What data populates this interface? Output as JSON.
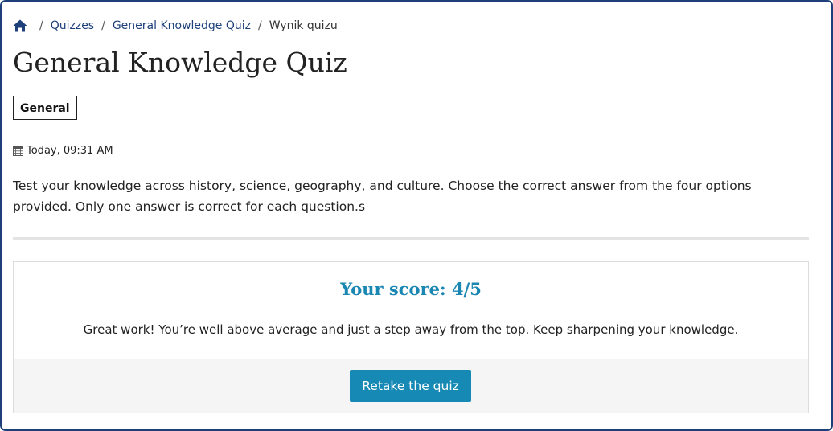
{
  "breadcrumb": {
    "home_icon": "home-icon",
    "separator": "/",
    "items": [
      {
        "label": "Quizzes"
      },
      {
        "label": "General Knowledge Quiz"
      }
    ],
    "current": "Wynik quizu"
  },
  "quiz": {
    "title": "General Knowledge Quiz",
    "category": "General",
    "date_icon": "calendar-icon",
    "date": "Today, 09:31 AM",
    "description": "Test your knowledge across history, science, geography, and culture. Choose the correct answer from the four options provided. Only one answer is correct for each question.s"
  },
  "result": {
    "score_title": "Your score: 4/5",
    "message": "Great work! You’re well above average and just a step away from the top. Keep sharpening your knowledge.",
    "retake_label": "Retake the quiz"
  },
  "colors": {
    "frame_border": "#1d3f7a",
    "link": "#1d3f7a",
    "score_accent": "#1a86b2",
    "button_bg": "#1789b5"
  }
}
